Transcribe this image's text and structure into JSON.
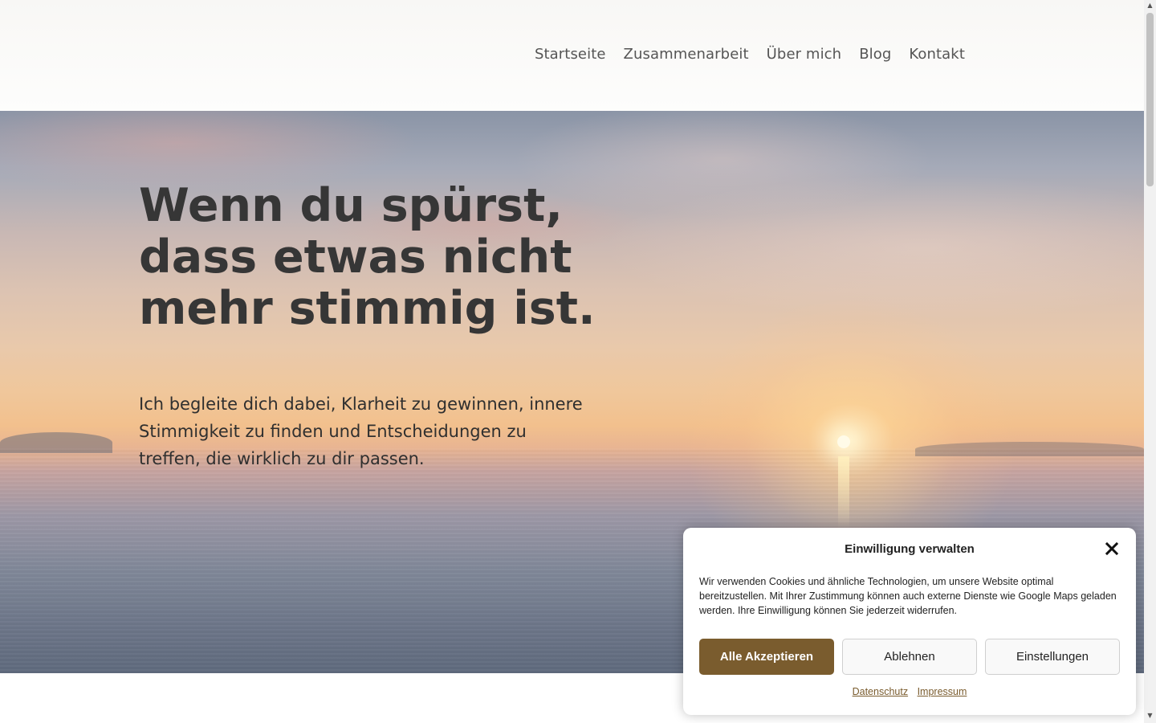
{
  "nav": {
    "items": [
      {
        "label": "Startseite"
      },
      {
        "label": "Zusammenarbeit"
      },
      {
        "label": "Über mich"
      },
      {
        "label": "Blog"
      },
      {
        "label": "Kontakt"
      }
    ]
  },
  "hero": {
    "title": "Wenn du spürst, dass etwas nicht mehr stimmig ist.",
    "text": "Ich begleite dich dabei, Klarheit zu gewinnen, innere Stimmigkeit zu finden und Entscheidungen zu treffen, die wirklich zu dir passen."
  },
  "consent": {
    "title": "Einwilligung verwalten",
    "close_icon": "close-icon",
    "text": "Wir verwenden Cookies und ähnliche Technologien, um unsere Website optimal bereitzustellen. Mit Ihrer Zustimmung können auch externe Dienste wie Google Maps geladen werden. Ihre Einwilligung können Sie jederzeit widerrufen.",
    "accept_label": "Alle Akzeptieren",
    "deny_label": "Ablehnen",
    "settings_label": "Einstellungen",
    "privacy_link": "Datenschutz",
    "imprint_link": "Impressum"
  },
  "colors": {
    "accent": "#7a5c2e",
    "nav_text": "#555555",
    "heading": "#363636"
  }
}
